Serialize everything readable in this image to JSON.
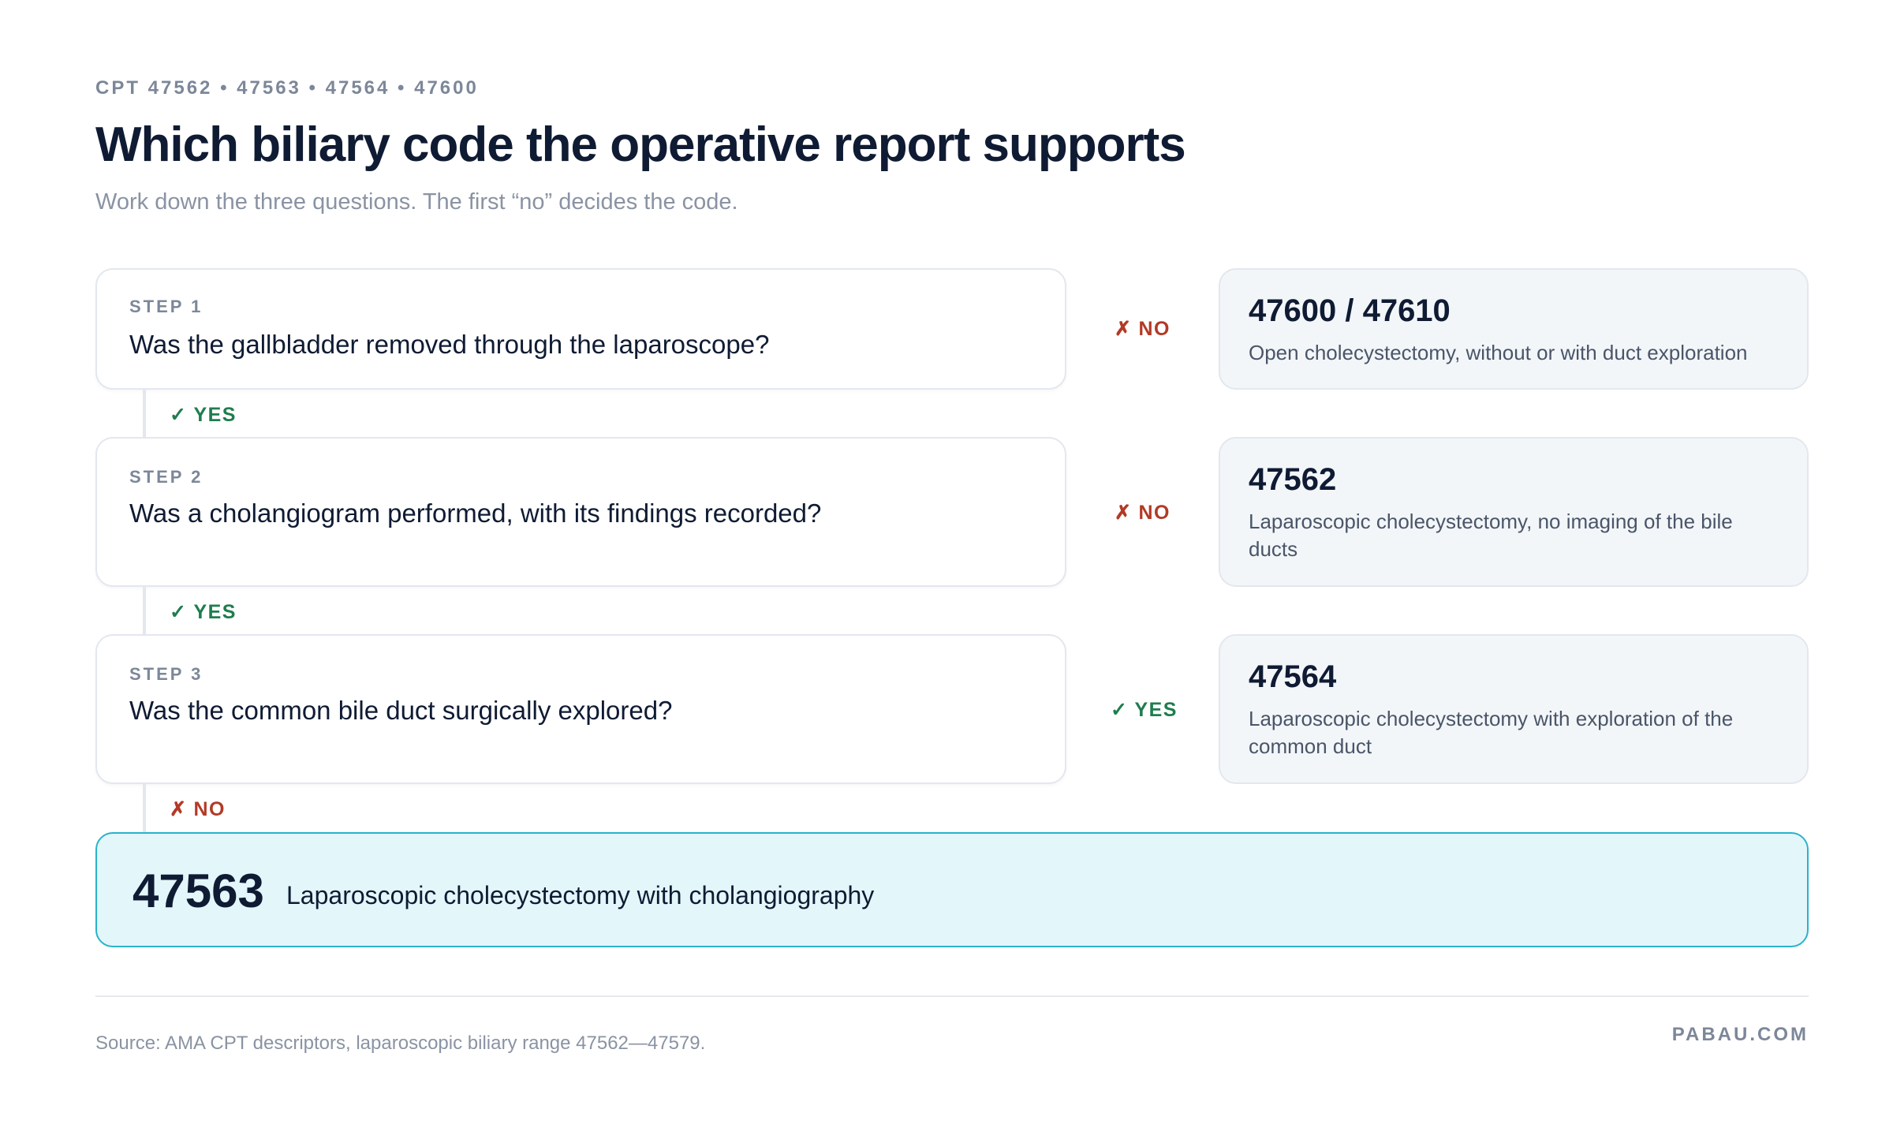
{
  "header": {
    "eyebrow": "CPT 47562 • 47563 • 47564 • 47600",
    "title": "Which biliary code the operative report supports",
    "subtitle": "Work down the three questions. The first “no” decides the code."
  },
  "steps": [
    {
      "label": "STEP 1",
      "question": "Was the gallbladder removed through the laparoscope?",
      "side_branch": {
        "mark": "✗",
        "text": "NO",
        "kind": "no"
      },
      "outcome": {
        "code": "47600 / 47610",
        "description": "Open cholecystectomy, without or with duct exploration"
      },
      "down_branch": {
        "mark": "✓",
        "text": "YES",
        "kind": "yes"
      }
    },
    {
      "label": "STEP 2",
      "question": "Was a cholangiogram performed, with its findings recorded?",
      "side_branch": {
        "mark": "✗",
        "text": "NO",
        "kind": "no"
      },
      "outcome": {
        "code": "47562",
        "description": "Laparoscopic cholecystectomy, no imaging of the bile ducts"
      },
      "down_branch": {
        "mark": "✓",
        "text": "YES",
        "kind": "yes"
      }
    },
    {
      "label": "STEP 3",
      "question": "Was the common bile duct surgically explored?",
      "side_branch": {
        "mark": "✓",
        "text": "YES",
        "kind": "yes"
      },
      "outcome": {
        "code": "47564",
        "description": "Laparoscopic cholecystectomy with exploration of the common duct"
      },
      "down_branch": {
        "mark": "✗",
        "text": "NO",
        "kind": "no"
      }
    }
  ],
  "final": {
    "code": "47563",
    "description": "Laparoscopic cholecystectomy with cholangiography"
  },
  "footer": {
    "source": "Source: AMA CPT descriptors, laparoscopic biliary range 47562—47579.",
    "brand": "PABAU.COM"
  },
  "colors": {
    "yes": "#1e7d4e",
    "no": "#b23a26",
    "highlight_border": "#28b3c9",
    "highlight_fill": "#e3f6fa"
  }
}
